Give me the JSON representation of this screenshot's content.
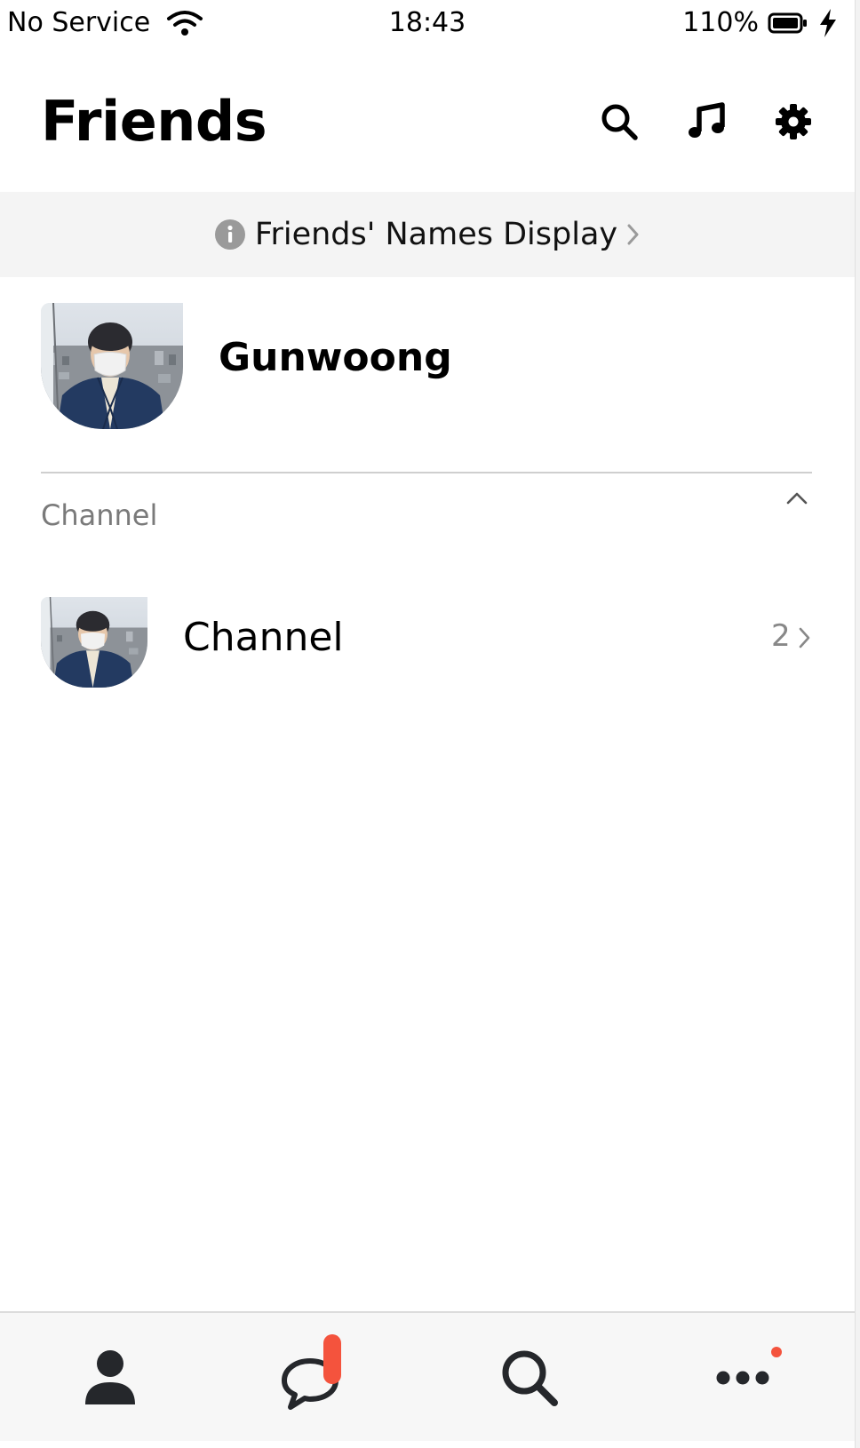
{
  "status_bar": {
    "carrier": "No Service",
    "time": "18:43",
    "battery": "110%"
  },
  "header": {
    "title": "Friends",
    "icons": [
      "search-icon",
      "music-note-icon",
      "gear-icon"
    ]
  },
  "banner": {
    "label": "Friends' Names Display"
  },
  "profile": {
    "name": "Gunwoong"
  },
  "section": {
    "title": "Channel"
  },
  "channel": {
    "name": "Channel",
    "count": "2"
  },
  "tabbar": {
    "tabs": [
      "person-icon",
      "chat-bubble-icon",
      "search-icon",
      "more-dots-icon"
    ],
    "badge_color": "#f4533d"
  },
  "colors": {
    "accent_badge": "#f4533d",
    "banner_bg": "#f4f4f4",
    "tabbar_bg": "#f7f7f7"
  }
}
